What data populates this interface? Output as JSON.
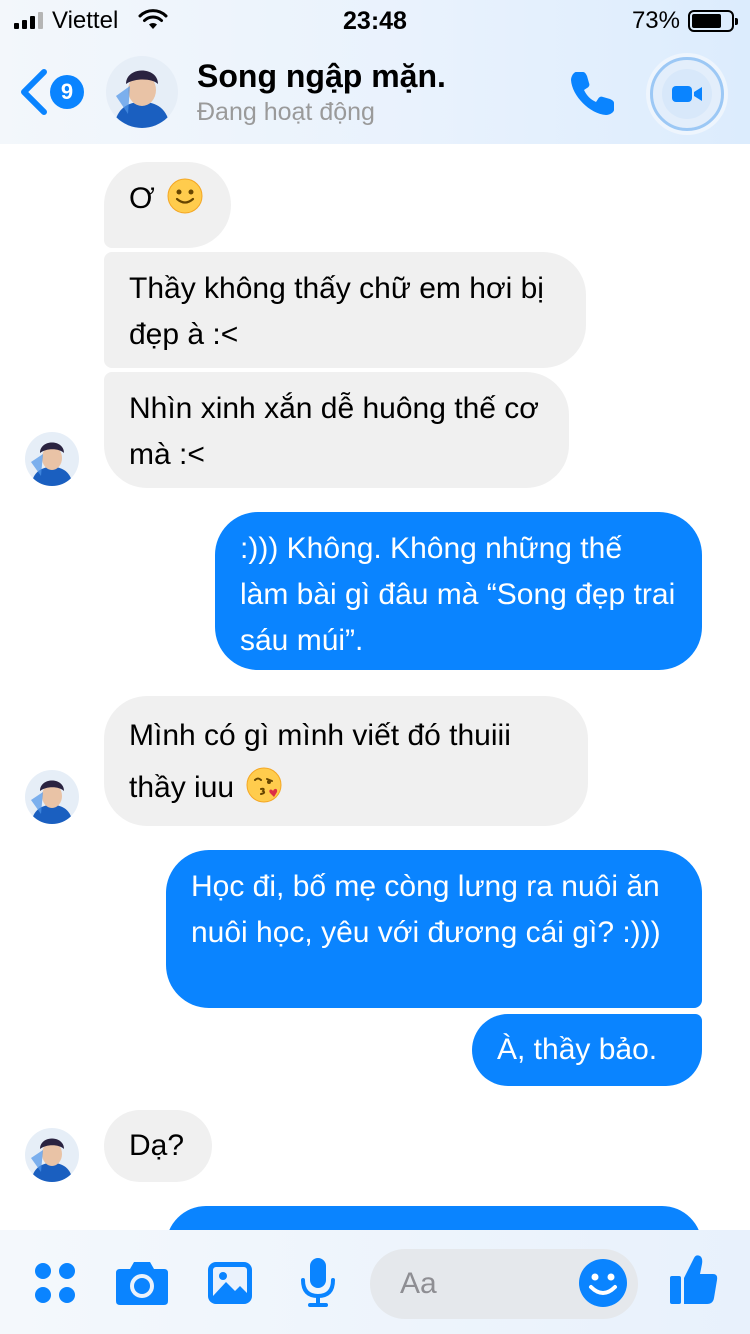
{
  "status": {
    "carrier": "Viettel",
    "time": "23:48",
    "battery": "73%",
    "battery_level": 0.73
  },
  "header": {
    "unread_count": "9",
    "contact_name": "Song ngập mặn.",
    "contact_status": "Đang hoạt động"
  },
  "messages": [
    {
      "side": "in",
      "text": "Ơ",
      "emoji": "slightly-smiling-face"
    },
    {
      "side": "in",
      "text": "Thầy không thấy chữ em hơi bị đẹp à :<"
    },
    {
      "side": "in",
      "text": "Nhìn xinh xắn dễ huông thế cơ mà :<"
    },
    {
      "side": "out",
      "text": ":))) Không. Không những thế làm bài gì đâu mà “Song đẹp trai sáu múi”."
    },
    {
      "side": "in",
      "text": "Mình có gì mình viết đó thuiii thầy iuu",
      "emoji": "face-blowing-kiss"
    },
    {
      "side": "out",
      "text": "Học đi, bố mẹ còng lưng ra nuôi ăn nuôi học, yêu với đương cái gì? :)))"
    },
    {
      "side": "out",
      "text": "À, thầy bảo."
    },
    {
      "side": "in",
      "text": "Dạ?"
    }
  ],
  "composer": {
    "placeholder": "Aa"
  },
  "colors": {
    "accent": "#0a84ff",
    "incoming_bubble": "#f0f0f0",
    "header_bg": "#e9f2fd"
  },
  "icons": [
    "back-chevron-icon",
    "phone-icon",
    "video-camera-icon",
    "apps-grid-icon",
    "camera-icon",
    "photo-gallery-icon",
    "microphone-icon",
    "emoji-icon",
    "thumbs-up-icon"
  ]
}
